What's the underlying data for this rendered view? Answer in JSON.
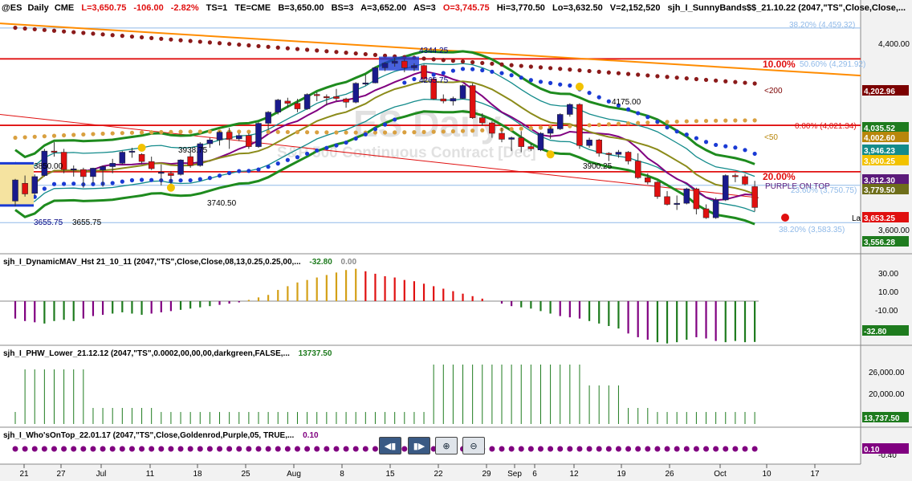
{
  "header": {
    "symbol": "@ES",
    "interval": "Daily",
    "exchange": "CME",
    "last": "L=3,650.75",
    "change": "-106.00",
    "change_pct": "-2.82%",
    "ts": "TS=1",
    "te": "TE=CME",
    "bid": "B=3,650.00",
    "bs": "BS=3",
    "ask": "A=3,652.00",
    "as": "AS=3",
    "open": "O=3,745.75",
    "high": "Hi=3,770.50",
    "low": "Lo=3,632.50",
    "volume": "V=2,152,520",
    "study": "sjh_I_SunnyBands$$_21.10.22 (2047,\"TS\",Close,Close,..."
  },
  "watermark": {
    "line1": "ES Daily",
    "line2": "S&P 500 Continuous Contract [Dec]"
  },
  "price_axis": {
    "ticks": [
      "4,400.00",
      "3,600.00"
    ],
    "labels": [
      {
        "text": "4,202.96",
        "color": "#7b0000"
      },
      {
        "text": "4,035.52",
        "color": "#1e7b1e"
      },
      {
        "text": "4,002.60",
        "color": "#b8860b"
      },
      {
        "text": "3,946.23",
        "color": "#138b8b"
      },
      {
        "text": "3,900.25",
        "color": "#f2c200"
      },
      {
        "text": "3,812.30",
        "color": "#5b1a7a"
      },
      {
        "text": "3,779.50",
        "color": "#6e6e1a"
      },
      {
        "text": "3,653.25",
        "color": "#e01010"
      },
      {
        "text": "3,556.28",
        "color": "#1e7b1e"
      }
    ]
  },
  "annotations": {
    "fib": [
      {
        "text": "38.20% (4,459.32)"
      },
      {
        "text": "50.60% (4,291.92)"
      },
      {
        "text": "0.00% (4,021.34)"
      },
      {
        "text": "23.60% (3,750.75)"
      },
      {
        "text": "38.20% (3,583.35)"
      }
    ],
    "pct10": "10.00%",
    "pct20": "20.00%",
    "lt200": "<200",
    "lt50": "<50",
    "purple_on_top": "PURPLE ON TOP",
    "la": "La",
    "price_labels": [
      {
        "text": "4344.25"
      },
      {
        "text": "4265.75"
      },
      {
        "text": "4175.00"
      },
      {
        "text": "3938.75"
      },
      {
        "text": "3850.00"
      },
      {
        "text": "3900.25"
      },
      {
        "text": "3740.50"
      },
      {
        "text": "3655.75"
      },
      {
        "text": "3655.75"
      }
    ]
  },
  "panel_macd": {
    "title": "sjh_I_DynamicMAV_Hst 21_10_11 (2047,\"TS\",Close,Close,08,13,0.25,0.25,00,...",
    "value1": "-32.80",
    "value2": "0.00",
    "ticks": [
      "30.00",
      "10.00",
      "-10.00"
    ],
    "last_label": "-32.80"
  },
  "panel_phw": {
    "title": "sjh_I_PHW_Lower_21.12.12 (2047,\"TS\",0.0002,00,00,00,darkgreen,FALSE,...",
    "value": "13737.50",
    "ticks": [
      "26,000.00",
      "20,000.00"
    ],
    "last_label": "13,737.50"
  },
  "panel_who": {
    "title": "sjh_I_Who'sOnTop_22.01.17 (2047,\"TS\",Close,Goldenrod,Purple,05, TRUE,...",
    "value": "0.10",
    "ticks": [
      "-0.40"
    ],
    "last_label": "0.10"
  },
  "x_axis": {
    "labels": [
      "21",
      "27",
      "Jul",
      "11",
      "18",
      "25",
      "Aug",
      "8",
      "15",
      "22",
      "29",
      "Sep",
      "6",
      "12",
      "19",
      "26",
      "Oct",
      "10",
      "17"
    ]
  },
  "controls": [
    {
      "name": "scroll-left-button",
      "icon": "scroll-left-icon",
      "glyph": "◀▮"
    },
    {
      "name": "scroll-right-button",
      "icon": "scroll-right-icon",
      "glyph": "▮▶"
    },
    {
      "name": "zoom-in-button",
      "icon": "zoom-in-icon",
      "glyph": "⊕"
    },
    {
      "name": "zoom-out-button",
      "icon": "zoom-out-icon",
      "glyph": "⊖"
    }
  ],
  "chart_data": {
    "type": "candlestick",
    "title": "@ES - Daily CME",
    "ylim": [
      3450,
      4520
    ],
    "dates": [
      "06/21",
      "06/22",
      "06/23",
      "06/24",
      "06/27",
      "06/28",
      "06/29",
      "06/30",
      "07/01",
      "07/05",
      "07/06",
      "07/07",
      "07/08",
      "07/11",
      "07/12",
      "07/13",
      "07/14",
      "07/15",
      "07/18",
      "07/19",
      "07/20",
      "07/21",
      "07/22",
      "07/25",
      "07/26",
      "07/27",
      "07/28",
      "07/29",
      "08/01",
      "08/02",
      "08/03",
      "08/04",
      "08/05",
      "08/08",
      "08/09",
      "08/10",
      "08/11",
      "08/12",
      "08/15",
      "08/16",
      "08/17",
      "08/18",
      "08/19",
      "08/22",
      "08/23",
      "08/24",
      "08/25",
      "08/26",
      "08/29",
      "08/30",
      "08/31",
      "09/01",
      "09/02",
      "09/06",
      "09/07",
      "09/08",
      "09/09",
      "09/12",
      "09/13",
      "09/14",
      "09/15",
      "09/16",
      "09/19",
      "09/20",
      "09/21",
      "09/22",
      "09/23",
      "09/26",
      "09/27",
      "09/28",
      "09/29",
      "09/30",
      "10/03",
      "10/04",
      "10/05",
      "10/06",
      "10/07"
    ],
    "ohlc": [
      [
        3680,
        3780,
        3656,
        3775
      ],
      [
        3760,
        3795,
        3700,
        3712
      ],
      [
        3715,
        3800,
        3705,
        3790
      ],
      [
        3795,
        3915,
        3790,
        3905
      ],
      [
        3905,
        3945,
        3880,
        3900
      ],
      [
        3900,
        3915,
        3805,
        3822
      ],
      [
        3820,
        3840,
        3790,
        3825
      ],
      [
        3822,
        3830,
        3740,
        3790
      ],
      [
        3790,
        3830,
        3760,
        3828
      ],
      [
        3820,
        3840,
        3745,
        3835
      ],
      [
        3835,
        3870,
        3805,
        3850
      ],
      [
        3850,
        3905,
        3845,
        3900
      ],
      [
        3900,
        3920,
        3875,
        3905
      ],
      [
        3890,
        3895,
        3845,
        3858
      ],
      [
        3858,
        3880,
        3820,
        3826
      ],
      [
        3810,
        3845,
        3750,
        3810
      ],
      [
        3805,
        3815,
        3740,
        3795
      ],
      [
        3800,
        3868,
        3795,
        3865
      ],
      [
        3880,
        3900,
        3830,
        3840
      ],
      [
        3840,
        3945,
        3835,
        3938
      ],
      [
        3938,
        3965,
        3920,
        3955
      ],
      [
        3955,
        3995,
        3930,
        3990
      ],
      [
        3990,
        4010,
        3915,
        3960
      ],
      [
        3960,
        3985,
        3950,
        3975
      ],
      [
        3975,
        3985,
        3915,
        3925
      ],
      [
        3925,
        4035,
        3920,
        4030
      ],
      [
        4030,
        4085,
        4000,
        4080
      ],
      [
        4080,
        4140,
        4070,
        4135
      ],
      [
        4130,
        4145,
        4100,
        4120
      ],
      [
        4120,
        4140,
        4080,
        4095
      ],
      [
        4095,
        4165,
        4090,
        4160
      ],
      [
        4160,
        4170,
        4130,
        4155
      ],
      [
        4150,
        4160,
        4110,
        4145
      ],
      [
        4150,
        4185,
        4130,
        4142
      ],
      [
        4140,
        4145,
        4100,
        4125
      ],
      [
        4125,
        4215,
        4120,
        4210
      ],
      [
        4210,
        4250,
        4200,
        4212
      ],
      [
        4212,
        4285,
        4210,
        4280
      ],
      [
        4280,
        4305,
        4265,
        4300
      ],
      [
        4300,
        4325,
        4285,
        4310
      ],
      [
        4310,
        4320,
        4260,
        4280
      ],
      [
        4280,
        4300,
        4265,
        4290
      ],
      [
        4290,
        4295,
        4215,
        4230
      ],
      [
        4230,
        4235,
        4135,
        4140
      ],
      [
        4140,
        4160,
        4120,
        4130
      ],
      [
        4130,
        4150,
        4110,
        4142
      ],
      [
        4142,
        4205,
        4140,
        4200
      ],
      [
        4200,
        4210,
        4050,
        4055
      ],
      [
        4055,
        4075,
        4020,
        4032
      ],
      [
        4032,
        4040,
        3965,
        3985
      ],
      [
        3985,
        4010,
        3945,
        3958
      ],
      [
        3958,
        3970,
        3905,
        3965
      ],
      [
        3965,
        3995,
        3900,
        3925
      ],
      [
        3925,
        3940,
        3905,
        3915
      ],
      [
        3910,
        3990,
        3905,
        3985
      ],
      [
        3985,
        4015,
        3960,
        4005
      ],
      [
        4005,
        4075,
        4000,
        4070
      ],
      [
        4070,
        4120,
        4060,
        4115
      ],
      [
        4115,
        4120,
        3915,
        3930
      ],
      [
        3930,
        3965,
        3920,
        3955
      ],
      [
        3955,
        3960,
        3880,
        3895
      ],
      [
        3895,
        3900,
        3860,
        3890
      ],
      [
        3890,
        3910,
        3875,
        3900
      ],
      [
        3900,
        3905,
        3845,
        3860
      ],
      [
        3860,
        3895,
        3780,
        3785
      ],
      [
        3785,
        3805,
        3755,
        3765
      ],
      [
        3765,
        3770,
        3690,
        3700
      ],
      [
        3700,
        3725,
        3660,
        3665
      ],
      [
        3665,
        3705,
        3640,
        3670
      ],
      [
        3670,
        3740,
        3665,
        3735
      ],
      [
        3735,
        3740,
        3620,
        3645
      ],
      [
        3645,
        3665,
        3600,
        3605
      ],
      [
        3605,
        3695,
        3600,
        3685
      ],
      [
        3685,
        3800,
        3680,
        3795
      ],
      [
        3795,
        3805,
        3765,
        3790
      ],
      [
        3790,
        3800,
        3750,
        3756
      ],
      [
        3745,
        3771,
        3633,
        3651
      ]
    ],
    "horizontal_levels": [
      4320,
      4021,
      3812,
      4459,
      3751,
      3583
    ],
    "indicator_dynamic_mav": [
      -14,
      -16,
      -17,
      -18,
      -16,
      -15,
      -16,
      -14,
      -12,
      -11,
      -10,
      -9,
      -10,
      -11,
      -10,
      -9,
      -8,
      -7,
      -6,
      -5,
      -4,
      -3,
      -2,
      -1,
      1,
      3,
      5,
      9,
      12,
      15,
      17,
      19,
      21,
      23,
      25,
      26,
      24,
      22,
      20,
      19,
      17,
      16,
      14,
      12,
      10,
      8,
      6,
      4,
      2,
      0,
      -2,
      -4,
      -5,
      -6,
      -8,
      -10,
      -12,
      -13,
      -14,
      -16,
      -18,
      -20,
      -22,
      -26,
      -29,
      -31,
      -33,
      -34,
      -33,
      -31,
      -29,
      -30,
      -32,
      -33,
      -32,
      -33,
      -32.8
    ],
    "indicator_phw": [
      13737,
      27000,
      27000,
      27000,
      27000,
      27000,
      27000,
      27000,
      15000,
      15000,
      15000,
      15000,
      15000,
      15000,
      15000,
      13737,
      13737,
      13737,
      13737,
      13737,
      13737,
      13737,
      13737,
      13737,
      13737,
      13737,
      13737,
      13737,
      13737,
      13737,
      13737,
      13737,
      13737,
      13737,
      13737,
      13737,
      13737,
      13737,
      13737,
      13737,
      13737,
      13737,
      13737,
      28500,
      28500,
      28500,
      28500,
      28500,
      28500,
      28500,
      28500,
      28500,
      28500,
      28500,
      28500,
      28500,
      28500,
      28500,
      28500,
      22000,
      22000,
      22000,
      22000,
      15000,
      15000,
      15000,
      13737,
      13737,
      13737,
      13737,
      13737,
      13737,
      13737,
      13737,
      13737,
      13737,
      13737
    ],
    "indicator_whos_on_top": 0.1
  }
}
